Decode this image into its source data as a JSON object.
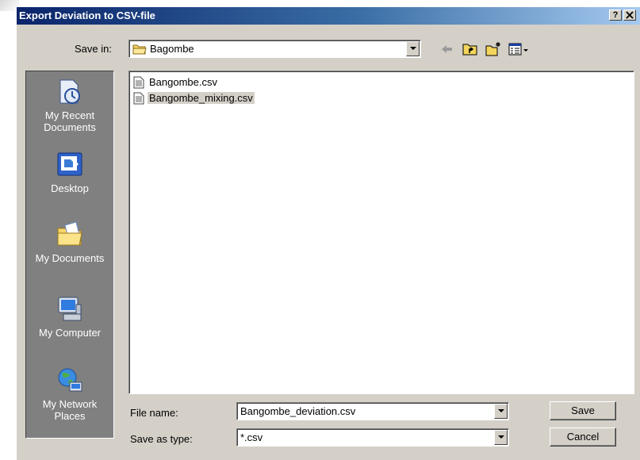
{
  "dialog": {
    "title": "Export Deviation to CSV-file",
    "help_label": "?",
    "close_label": "✕"
  },
  "save_in": {
    "label": "Save in:",
    "value": "Bagombe"
  },
  "toolbar": {
    "icons": [
      "back-arrow-icon",
      "up-one-level-icon",
      "new-folder-icon",
      "view-menu-icon"
    ]
  },
  "places": [
    {
      "icon": "my-recent-documents-icon",
      "label": "My Recent Documents"
    },
    {
      "icon": "desktop-icon",
      "label": "Desktop"
    },
    {
      "icon": "my-documents-icon",
      "label": "My Documents"
    },
    {
      "icon": "my-computer-icon",
      "label": "My Computer"
    },
    {
      "icon": "my-network-places-icon",
      "label": "My Network Places"
    }
  ],
  "files": [
    {
      "name": "Bangombe.csv",
      "selected": false
    },
    {
      "name": "Bangombe_mixing.csv",
      "selected": true
    }
  ],
  "file_name": {
    "label": "File name:",
    "value": "Bangombe_deviation.csv"
  },
  "save_as_type": {
    "label": "Save as type:",
    "value": "*.csv"
  },
  "buttons": {
    "save": "Save",
    "cancel": "Cancel"
  },
  "colors": {
    "title_bar_start": "#0a246a",
    "title_bar_end": "#a6caf0",
    "dialog_face": "#d4d0c8",
    "places_bar": "#808080"
  }
}
